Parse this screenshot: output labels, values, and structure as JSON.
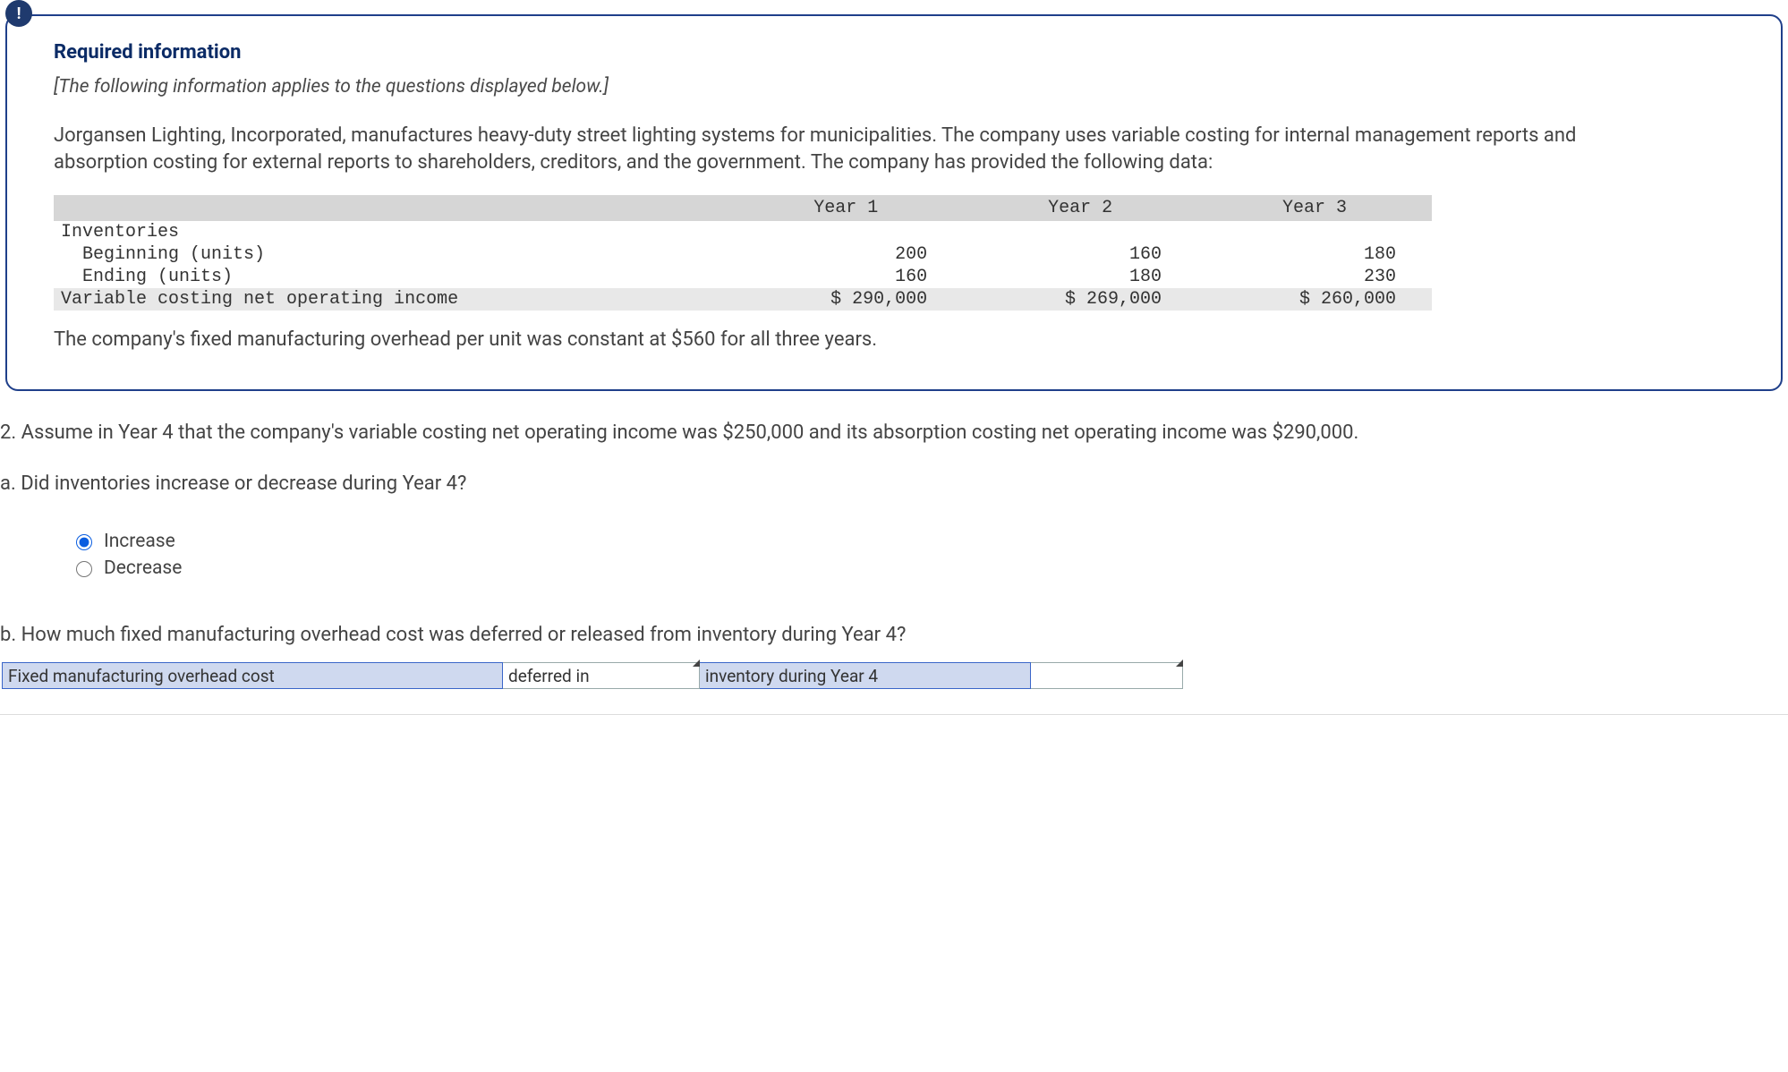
{
  "alert_symbol": "!",
  "info": {
    "heading": "Required information",
    "note": "[The following information applies to the questions displayed below.]",
    "paragraph": "Jorgansen Lighting, Incorporated, manufactures heavy-duty street lighting systems for municipalities. The company uses variable costing for internal management reports and absorption costing for external reports to shareholders, creditors, and the government. The company has provided the following data:",
    "followup": "The company's fixed manufacturing overhead per unit was constant at $560 for all three years."
  },
  "table": {
    "headers": {
      "blank": "",
      "y1": "Year 1",
      "y2": "Year 2",
      "y3": "Year 3"
    },
    "rows": {
      "inv_label": "Inventories",
      "beg": {
        "label": "  Beginning (units)",
        "y1": "200",
        "y2": "160",
        "y3": "180"
      },
      "end": {
        "label": "  Ending (units)",
        "y1": "160",
        "y2": "180",
        "y3": "230"
      },
      "vc": {
        "label": "Variable costing net operating income",
        "y1": "$ 290,000",
        "y2": "$ 269,000",
        "y3": "$ 260,000"
      }
    }
  },
  "q2": {
    "prompt": "2. Assume in Year 4 that the company's variable costing net operating income was $250,000 and its absorption costing net operating income was $290,000.",
    "part_a": "a. Did inventories increase or decrease during Year 4?",
    "radio_increase": "Increase",
    "radio_decrease": "Decrease",
    "part_b": "b. How much fixed manufacturing overhead cost was deferred or released from inventory during Year 4?"
  },
  "answer_row": {
    "cell_a": "Fixed manufacturing overhead cost",
    "cell_b": "deferred in",
    "cell_c": "inventory during Year 4",
    "cell_d_value": ""
  }
}
